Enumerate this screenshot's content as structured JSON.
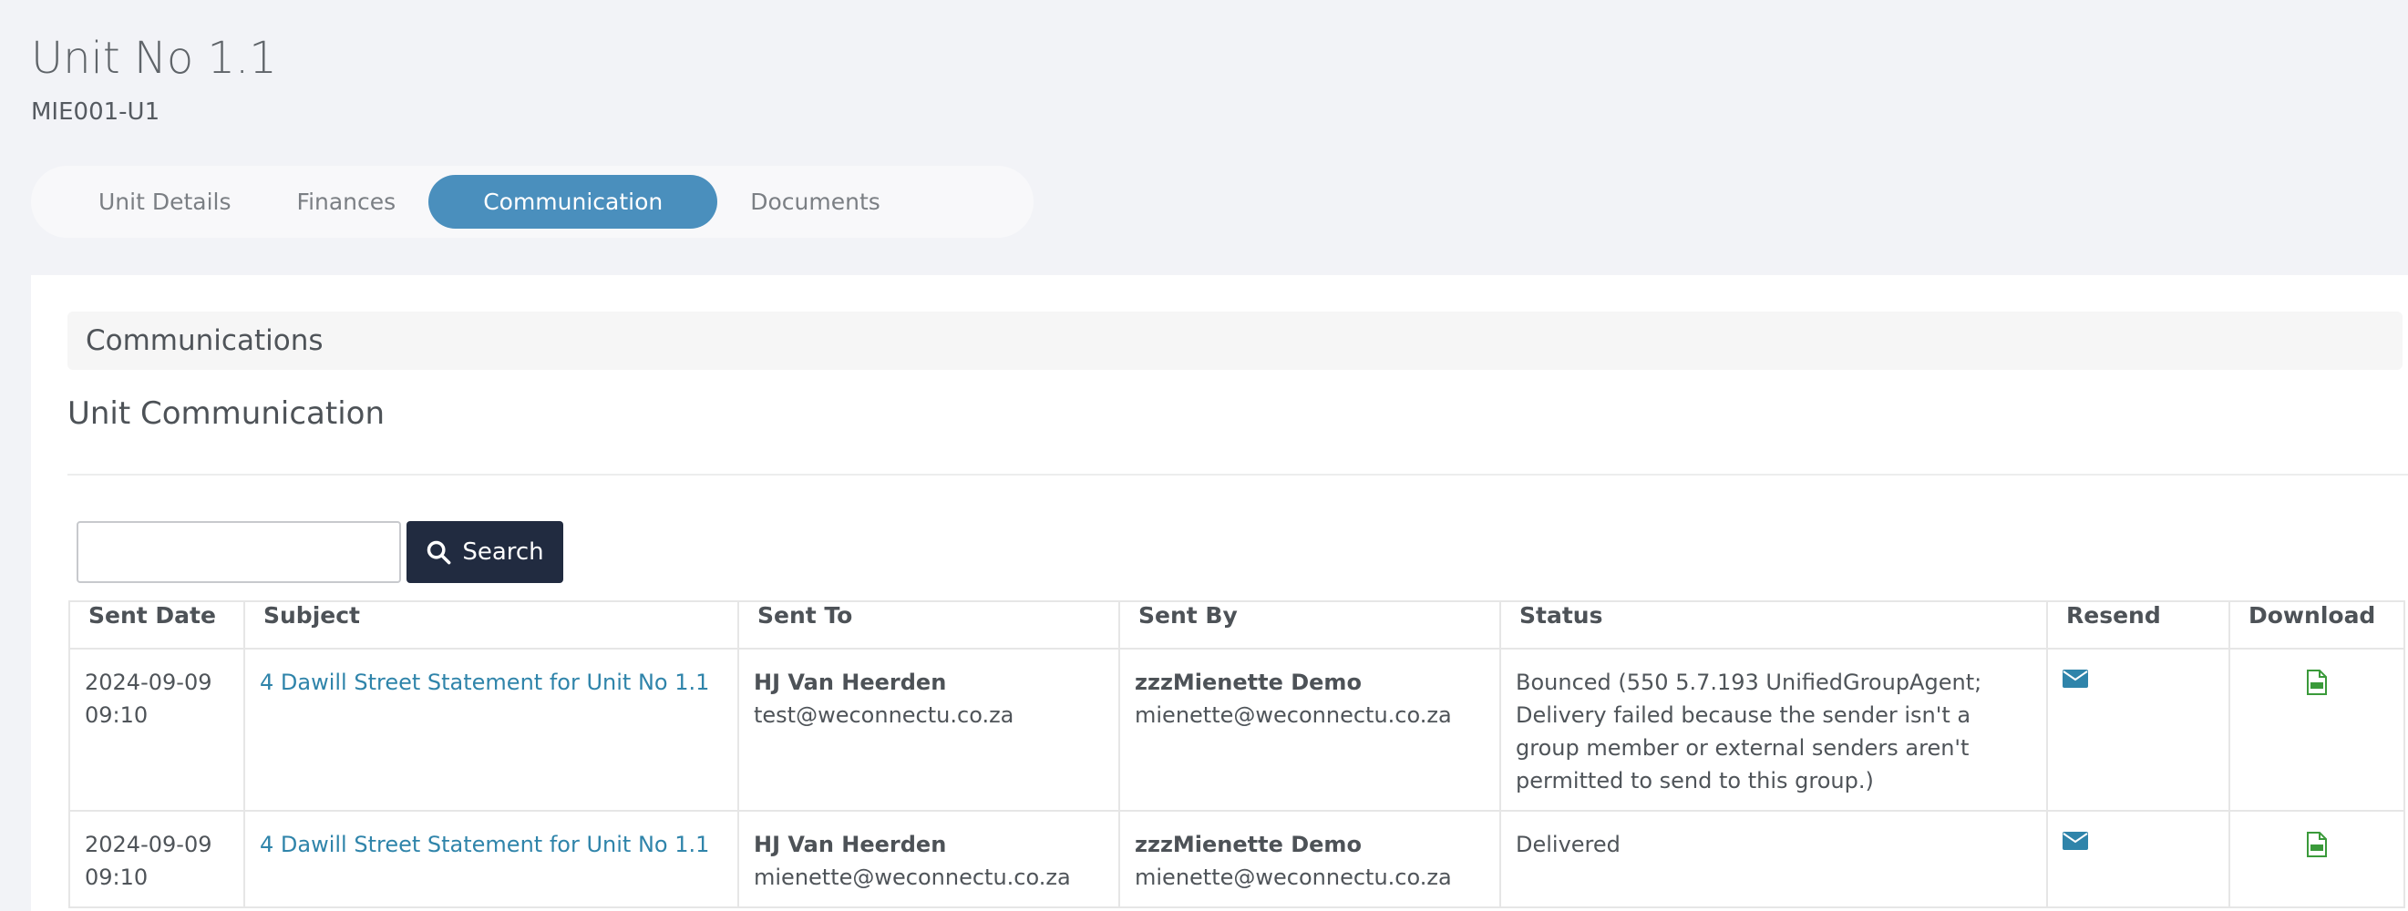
{
  "header": {
    "title": "Unit No 1.1",
    "code": "MIE001-U1"
  },
  "tabs": [
    {
      "label": "Unit Details",
      "active": false
    },
    {
      "label": "Finances",
      "active": false
    },
    {
      "label": "Communication",
      "active": true
    },
    {
      "label": "Documents",
      "active": false
    }
  ],
  "section": {
    "bar_title": "Communications",
    "title": "Unit Communication"
  },
  "search": {
    "value": "",
    "button_label": "Search",
    "icon": "search-icon"
  },
  "table": {
    "columns": [
      "Sent Date",
      "Subject",
      "Sent To",
      "Sent By",
      "Status",
      "Resend",
      "Download"
    ],
    "rows": [
      {
        "date": "2024-09-09",
        "time": "09:10",
        "subject": "4 Dawill Street Statement for Unit No 1.1",
        "to_name": "HJ Van Heerden",
        "to_email": "test@weconnectu.co.za",
        "by_name": "zzzMienette Demo",
        "by_email": "mienette@weconnectu.co.za",
        "status": "Bounced (550 5.7.193 UnifiedGroupAgent; Delivery failed because the sender isn't a group member or external senders aren't permitted to send to this group.)",
        "resend_icon": "envelope-icon",
        "download_icon": "pdf-file-icon"
      },
      {
        "date": "2024-09-09",
        "time": "09:10",
        "subject": "4 Dawill Street Statement for Unit No 1.1",
        "to_name": "HJ Van Heerden",
        "to_email": "mienette@weconnectu.co.za",
        "by_name": "zzzMienette Demo",
        "by_email": "mienette@weconnectu.co.za",
        "status": "Delivered",
        "resend_icon": "envelope-icon",
        "download_icon": "pdf-file-icon"
      }
    ]
  },
  "colors": {
    "accent": "#4a8fbd",
    "link": "#2f84aa",
    "button_dark": "#212b40",
    "pdf_green": "#3a9a3a"
  }
}
